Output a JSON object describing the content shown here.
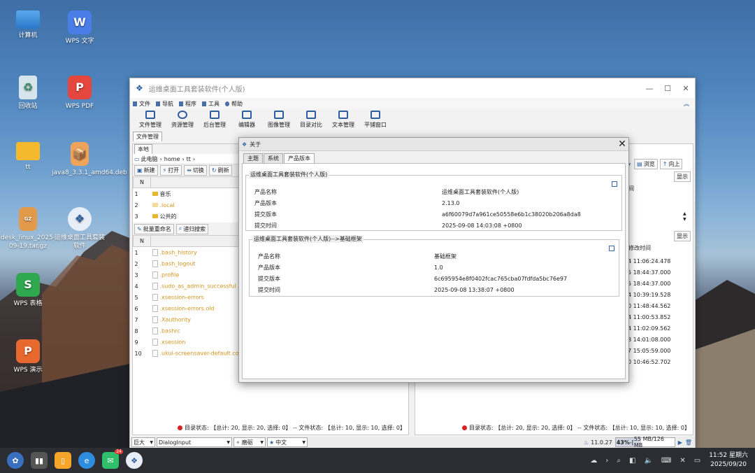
{
  "desktop": {
    "icons": [
      {
        "label": "计算机",
        "icon": "computer-icon"
      },
      {
        "label": "WPS 文字",
        "icon": "wps-writer-icon"
      },
      {
        "label": "回收站",
        "icon": "trash-icon"
      },
      {
        "label": "WPS PDF",
        "icon": "wps-pdf-icon"
      },
      {
        "label": "tt",
        "icon": "folder-icon"
      },
      {
        "label": "java8_3.3.1_amd64.deb",
        "icon": "deb-package-icon"
      },
      {
        "label": "desk_linux_2025-09-19.tar.gz",
        "icon": "archive-icon"
      },
      {
        "label": "运维桌面工具套装软件",
        "icon": "app-icon"
      },
      {
        "label": "WPS 表格",
        "icon": "wps-spreadsheet-icon"
      },
      {
        "label": "WPS 演示",
        "icon": "wps-presentation-icon"
      }
    ]
  },
  "window": {
    "title": "运维桌面工具套装软件(个人版)",
    "menu": [
      "文件",
      "导航",
      "程序",
      "工具",
      "帮助"
    ],
    "toolbar": [
      "文件管理",
      "资源管理",
      "后台管理",
      "编辑器",
      "图像管理",
      "目录对比",
      "文本管理",
      "平铺窗口"
    ],
    "main_tab": "文件管理",
    "left": {
      "sub_tab": "本地",
      "breadcrumb": [
        "此电脑",
        "home",
        "tt"
      ],
      "buttons": [
        "新建",
        "打开",
        "切换",
        "刷新"
      ],
      "header": [
        "N",
        "文件名称"
      ],
      "dirs": [
        {
          "n": "1",
          "name": "音乐"
        },
        {
          "n": "2",
          "name": ".local"
        },
        {
          "n": "3",
          "name": "公共的"
        }
      ],
      "buttons2": [
        "批量重命名",
        "递归搜索"
      ],
      "files": [
        {
          "n": "1",
          "name": ".bash_history"
        },
        {
          "n": "2",
          "name": ".bash_logout"
        },
        {
          "n": "3",
          "name": ".profile"
        },
        {
          "n": "4",
          "name": ".sudo_as_admin_successful"
        },
        {
          "n": "5",
          "name": ".xsession-errors"
        },
        {
          "n": "6",
          "name": ".xsession-errors.old"
        },
        {
          "n": "7",
          "name": ".Xauthority"
        },
        {
          "n": "8",
          "name": ".bashrc"
        },
        {
          "n": "9",
          "name": ".xsession"
        },
        {
          "n": "10",
          "name": ".ukui-screensaver-default.conf"
        }
      ],
      "status": "目录状态: 【总计: 20, 显示: 20, 选择: 0】 -- 文件状态: 【总计: 10, 显示: 10, 选择: 0】"
    },
    "right": {
      "buttons": [
        "浏览",
        "向上"
      ],
      "show_label": "显示",
      "col_time_short": "间",
      "col_time": "修改时间",
      "times": [
        "4 11:06:24.478",
        "5 18:44:37.000",
        "5 18:44:37.000",
        "4 10:39:19.528",
        "0 11:48:44.562",
        "4 11:00:53.852",
        "4 11:02:09.562",
        "8 14:01:08.000",
        "7 15:05:59.000",
        "0 10:46:52.702"
      ],
      "status": "目录状态: 【总计: 20, 显示: 20, 选择: 0】 -- 文件状态: 【总计: 10, 显示: 10, 选择: 0】"
    },
    "bottom": {
      "font_size": "巨大",
      "font_name": "DialogInput",
      "theme": "磨砺",
      "language": "中文",
      "version": "11.0.27",
      "memory_pct": "43%",
      "memory": "55 MB/126 MB",
      "memory_progress": 0.43
    }
  },
  "dialog": {
    "title": "关于",
    "tabs": [
      "主题",
      "系统",
      "产品版本"
    ],
    "active_tab": "产品版本",
    "group1": {
      "title": "运维桌面工具套装软件(个人版)",
      "rows": [
        {
          "k": "产品名称",
          "v": "运维桌面工具套装软件(个人版)"
        },
        {
          "k": "产品版本",
          "v": "2.13.0"
        },
        {
          "k": "提交版本",
          "v": "a6f60079d7a961ce50558e6b1c38020b206a8da8"
        },
        {
          "k": "提交时间",
          "v": "2025-09-08 14:03:08 +0800"
        }
      ]
    },
    "group2": {
      "title": "运维桌面工具套装软件(个人版)-->基础框架",
      "rows": [
        {
          "k": "产品名称",
          "v": "基础框架"
        },
        {
          "k": "产品版本",
          "v": "1.0"
        },
        {
          "k": "提交版本",
          "v": "6c695954e8f0402fcac765cba07fdfda5bc76e97"
        },
        {
          "k": "提交时间",
          "v": "2025-09-08 13:38:07 +0800"
        }
      ]
    }
  },
  "taskbar": {
    "badge": "24",
    "time": "11:52 星期六",
    "date": "2025/09/20"
  },
  "colors": {
    "accent": "#2d5f9e",
    "folder": "#e9b530",
    "file_text": "#d69522",
    "status_dot": "#d92323"
  }
}
